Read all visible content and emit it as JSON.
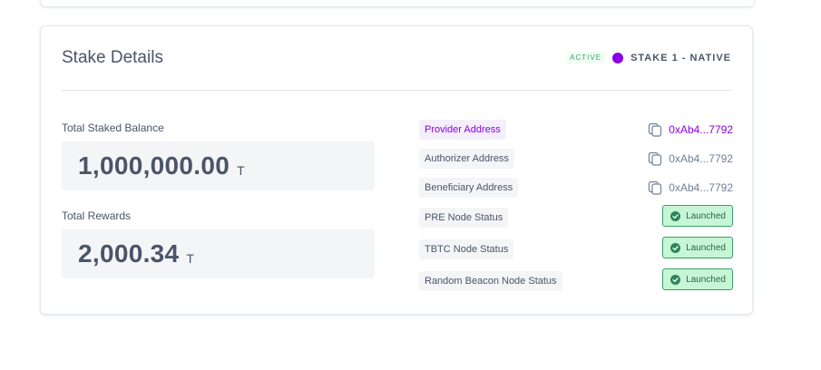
{
  "card": {
    "title": "Stake Details",
    "status_badge": "ACTIVE",
    "stake_name": "STAKE 1 - NATIVE"
  },
  "balances": {
    "staked_label": "Total Staked Balance",
    "staked_value": "1,000,000.00",
    "staked_unit": "T",
    "rewards_label": "Total Rewards",
    "rewards_value": "2,000.34",
    "rewards_unit": "T"
  },
  "addresses": [
    {
      "label": "Provider Address",
      "value": "0xAb4...7792"
    },
    {
      "label": "Authorizer Address",
      "value": "0xAb4...7792"
    },
    {
      "label": "Beneficiary Address",
      "value": "0xAb4...7792"
    }
  ],
  "node_statuses": [
    {
      "label": "PRE Node Status",
      "status": "Launched"
    },
    {
      "label": "TBTC Node Status",
      "status": "Launched"
    },
    {
      "label": "Random Beacon Node Status",
      "status": "Launched"
    }
  ],
  "colors": {
    "accent": "#8a00e6",
    "success": "#38a169",
    "success_bg": "#c6f6d5"
  },
  "icons": {
    "copy": "copy-icon",
    "check": "check-circle-icon",
    "dot": "stake-dot-icon"
  }
}
